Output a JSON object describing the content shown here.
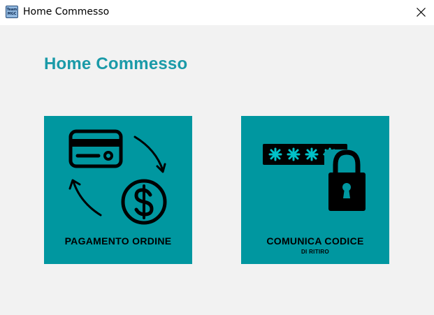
{
  "window": {
    "title": "Home Commesso",
    "app_icon_lines": [
      "Team",
      "MGC"
    ]
  },
  "page": {
    "title": "Home Commesso"
  },
  "tiles": [
    {
      "label": "PAGAMENTO ORDINE",
      "icon": "card-to-dollar-payment-icon"
    },
    {
      "label": "COMUNICA CODICE",
      "sublabel": "DI RITIRO",
      "icon": "password-padlock-icon"
    }
  ],
  "colors": {
    "accent": "#1a9aa8",
    "tile": "#0097a0",
    "background": "#f2f2f2",
    "icon": "#000000"
  }
}
